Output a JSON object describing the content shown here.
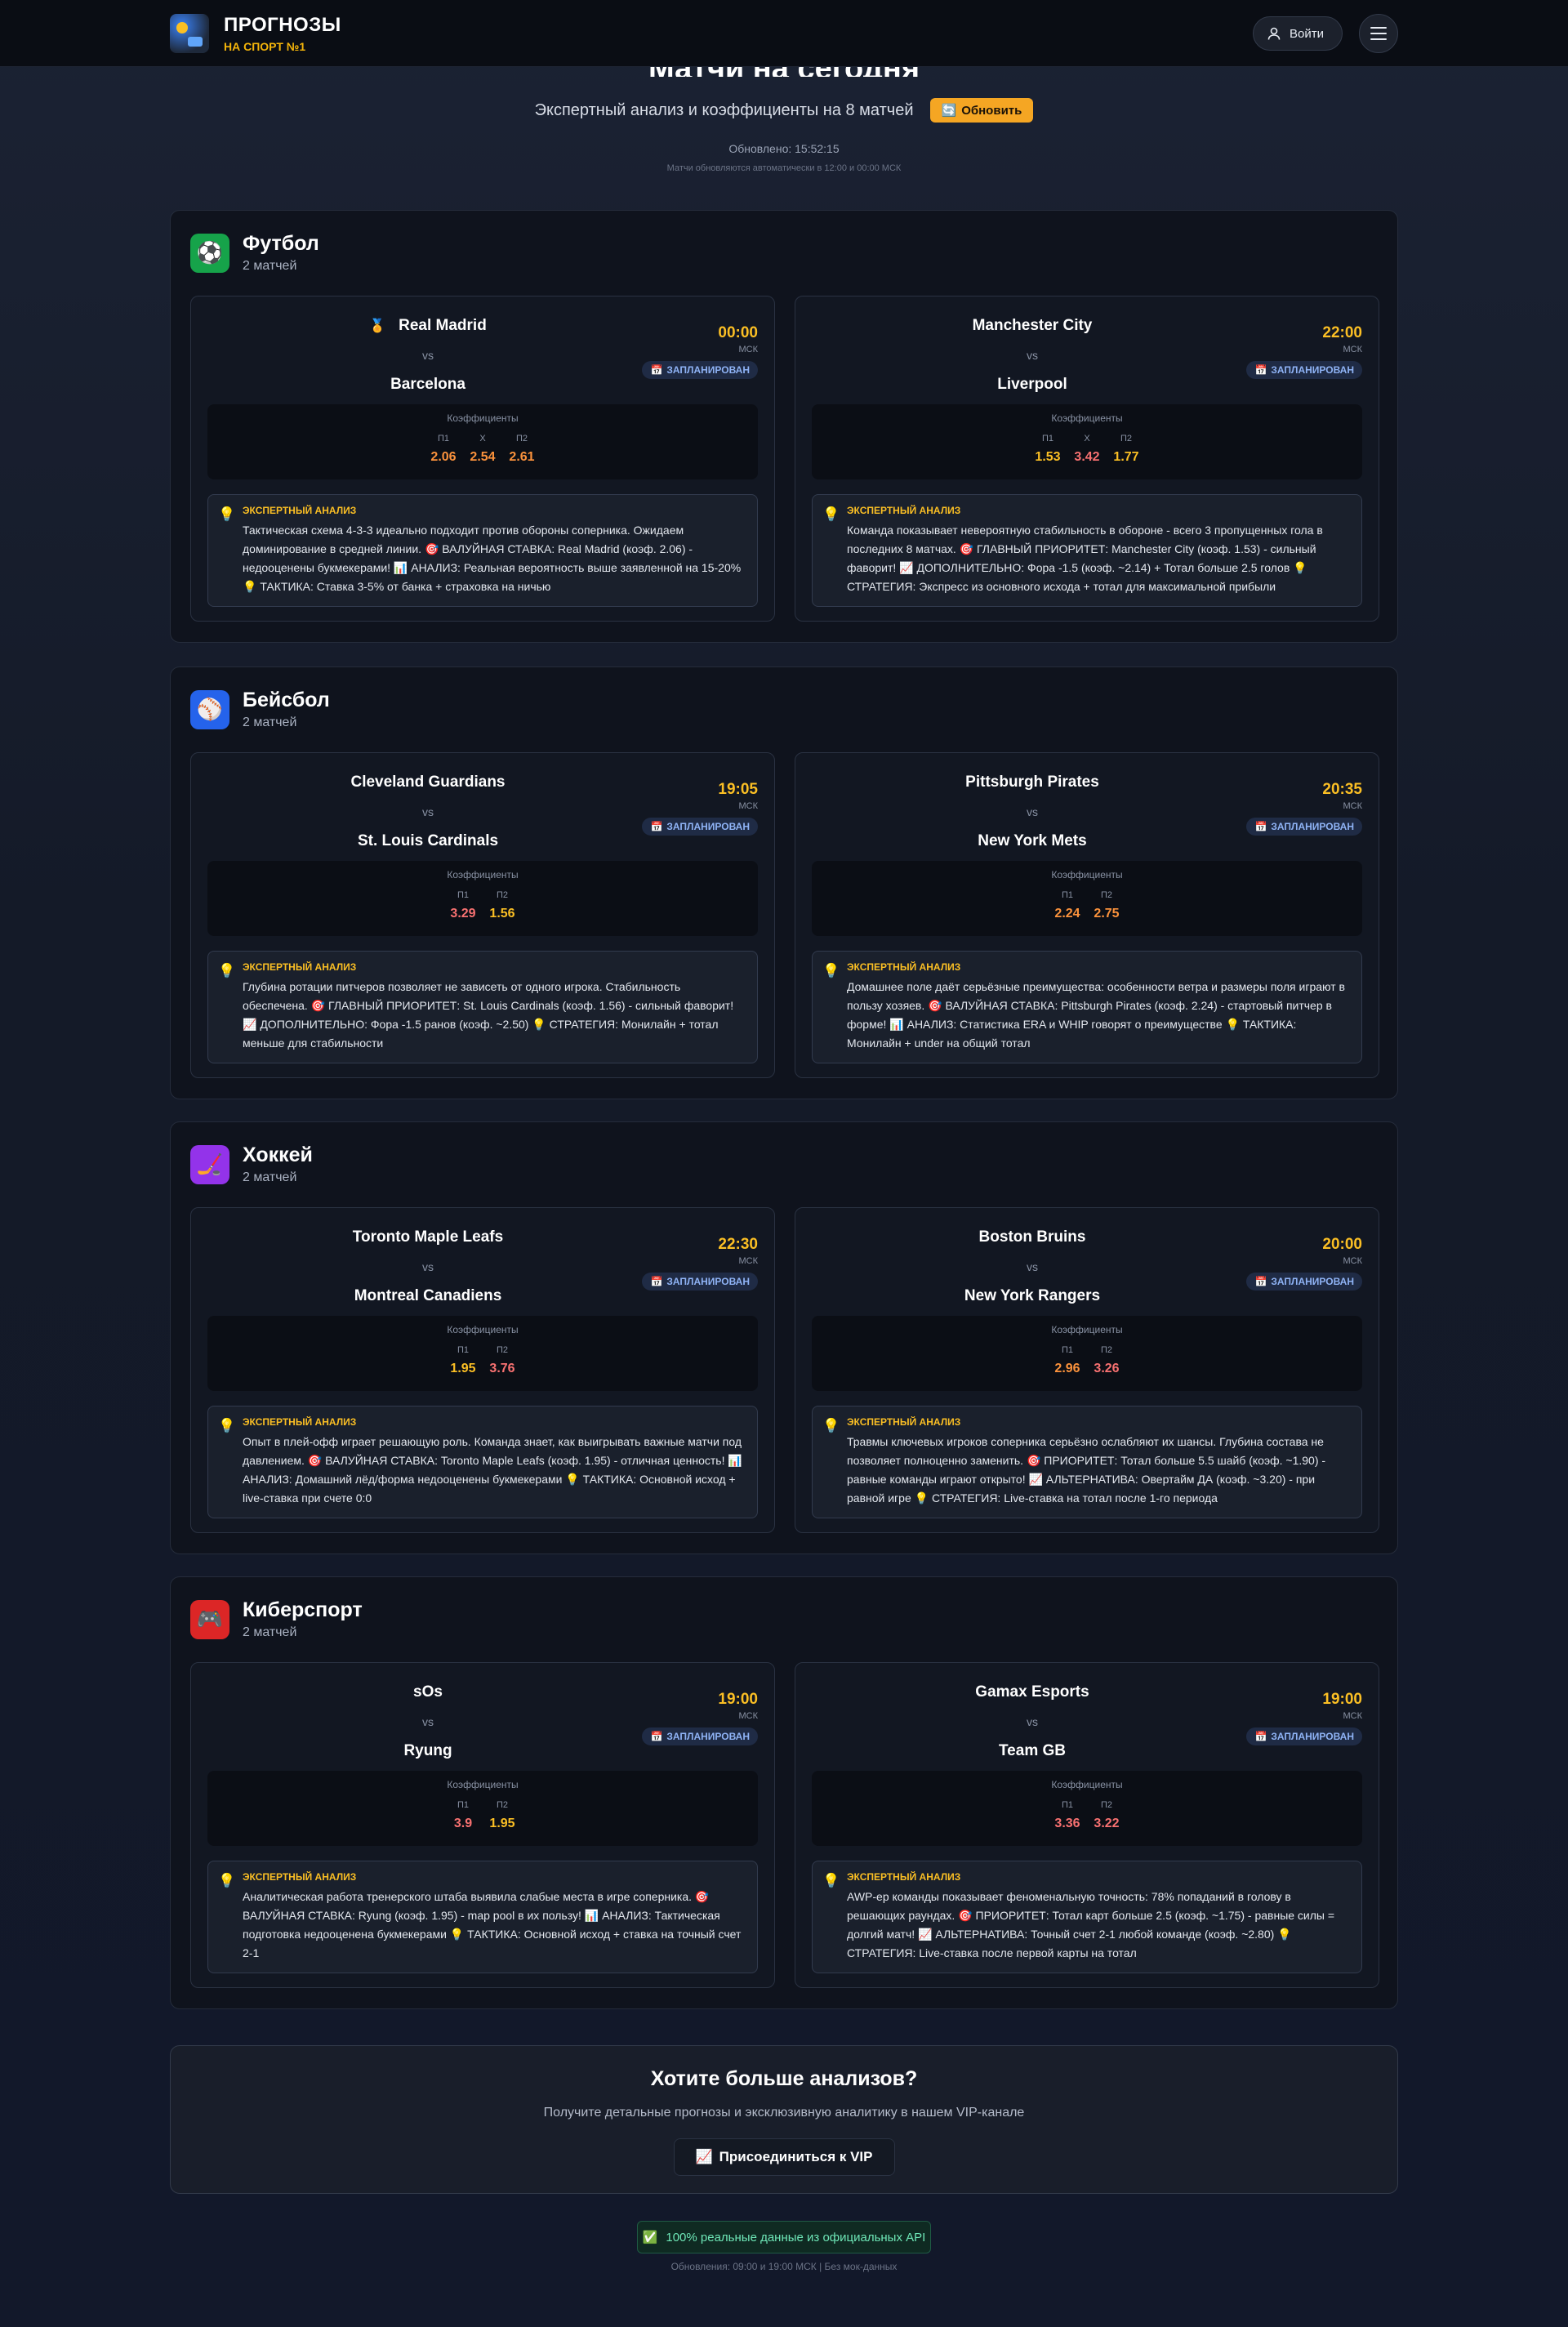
{
  "brand": {
    "title": "ПРОГНОЗЫ",
    "subtitle": "НА СПОРТ №1",
    "login_label": "Войти"
  },
  "hero": {
    "title": "Матчи на сегодня",
    "subtitle": "Экспертный анализ и коэффициенты на 8 матчей",
    "refresh_label": "Обновить",
    "updated": "Обновлено: 15:52:15",
    "note": "Матчи обновляются автоматически в 12:00 и 00:00 МСК"
  },
  "labels": {
    "vs": "vs",
    "tz": "МСК",
    "status": "ЗАПЛАНИРОВАН",
    "odds_title": "Коэффициенты",
    "p1": "П1",
    "x": "X",
    "p2": "П2",
    "analysis_title": "ЭКСПЕРТНЫЙ АНАЛИЗ"
  },
  "sections": [
    {
      "name": "Футбол",
      "count": "2 матчей",
      "icon": "soccer-ball-icon",
      "color": "#16a34a",
      "matches": [
        {
          "home": "Real Madrid",
          "away": "Barcelona",
          "time": "00:00",
          "p1": "2.06",
          "x": "2.54",
          "p2": "2.61",
          "analysis": "Тактическая схема 4-3-3 идеально подходит против обороны соперника. Ожидаем доминирование в средней линии. 🎯 ВАЛУЙНАЯ СТАВКА: Real Madrid (коэф. 2.06) - недооценены букмекерами! 📊 АНАЛИЗ: Реальная вероятность выше заявленной на 15-20% 💡 ТАКТИКА: Ставка 3-5% от банка + страховка на ничью"
        },
        {
          "home": "Manchester City",
          "away": "Liverpool",
          "time": "22:00",
          "p1": "1.53",
          "x": "3.42",
          "p2": "1.77",
          "analysis": "Команда показывает невероятную стабильность в обороне - всего 3 пропущенных гола в последних 8 матчах. 🎯 ГЛАВНЫЙ ПРИОРИТЕТ: Manchester City (коэф. 1.53) - сильный фаворит! 📈 ДОПОЛНИТЕЛЬНО: Фора -1.5 (коэф. ~2.14) + Тотал больше 2.5 голов 💡 СТРАТЕГИЯ: Экспресс из основного исхода + тотал для максимальной прибыли"
        }
      ]
    },
    {
      "name": "Бейсбол",
      "count": "2 матчей",
      "icon": "baseball-icon",
      "color": "#2563eb",
      "matches": [
        {
          "home": "Cleveland Guardians",
          "away": "St. Louis Cardinals",
          "time": "19:05",
          "p1": "3.29",
          "p2": "1.56",
          "analysis": "Глубина ротации питчеров позволяет не зависеть от одного игрока. Стабильность обеспечена. 🎯 ГЛАВНЫЙ ПРИОРИТЕТ: St. Louis Cardinals (коэф. 1.56) - сильный фаворит! 📈 ДОПОЛНИТЕЛЬНО: Фора -1.5 ранов (коэф. ~2.50) 💡 СТРАТЕГИЯ: Монилайн + тотал меньше для стабильности"
        },
        {
          "home": "Pittsburgh Pirates",
          "away": "New York Mets",
          "time": "20:35",
          "p1": "2.24",
          "p2": "2.75",
          "analysis": "Домашнее поле даёт серьёзные преимущества: особенности ветра и размеры поля играют в пользу хозяев. 🎯 ВАЛУЙНАЯ СТАВКА: Pittsburgh Pirates (коэф. 2.24) - стартовый питчер в форме! 📊 АНАЛИЗ: Статистика ERA и WHIP говорят о преимуществе 💡 ТАКТИКА: Монилайн + under на общий тотал"
        }
      ]
    },
    {
      "name": "Хоккей",
      "count": "2 матчей",
      "icon": "hockey-stick-icon",
      "color": "#9333ea",
      "matches": [
        {
          "home": "Toronto Maple Leafs",
          "away": "Montreal Canadiens",
          "time": "22:30",
          "p1": "1.95",
          "p2": "3.76",
          "analysis": "Опыт в плей-офф играет решающую роль. Команда знает, как выигрывать важные матчи под давлением. 🎯 ВАЛУЙНАЯ СТАВКА: Toronto Maple Leafs (коэф. 1.95) - отличная ценность! 📊 АНАЛИЗ: Домашний лёд/форма недооценены букмекерами 💡 ТАКТИКА: Основной исход + live-ставка при счете 0:0"
        },
        {
          "home": "Boston Bruins",
          "away": "New York Rangers",
          "time": "20:00",
          "p1": "2.96",
          "p2": "3.26",
          "analysis": "Травмы ключевых игроков соперника серьёзно ослабляют их шансы. Глубина состава не позволяет полноценно заменить. 🎯 ПРИОРИТЕТ: Тотал больше 5.5 шайб (коэф. ~1.90) - равные команды играют открыто! 📈 АЛЬТЕРНАТИВА: Овертайм ДА (коэф. ~3.20) - при равной игре 💡 СТРАТЕГИЯ: Live-ставка на тотал после 1-го периода"
        }
      ]
    },
    {
      "name": "Киберспорт",
      "count": "2 матчей",
      "icon": "gamepad-icon",
      "color": "#dc2626",
      "matches": [
        {
          "home": "sOs",
          "away": "Ryung",
          "time": "19:00",
          "p1": "3.9",
          "p2": "1.95",
          "analysis": "Аналитическая работа тренерского штаба выявила слабые места в игре соперника. 🎯 ВАЛУЙНАЯ СТАВКА: Ryung (коэф. 1.95) - map pool в их пользу! 📊 АНАЛИЗ: Тактическая подготовка недооценена букмекерами 💡 ТАКТИКА: Основной исход + ставка на точный счет 2-1"
        },
        {
          "home": "Gamax Esports",
          "away": "Team GB",
          "time": "19:00",
          "p1": "3.36",
          "p2": "3.22",
          "analysis": "AWP-ер команды показывает феноменальную точность: 78% попаданий в голову в решающих раундах. 🎯 ПРИОРИТЕТ: Тотал карт больше 2.5 (коэф. ~1.75) - равные силы = долгий матч! 📈 АЛЬТЕРНАТИВА: Точный счет 2-1 любой команде (коэф. ~2.80) 💡 СТРАТЕГИЯ: Live-ставка после первой карты на тотал"
        }
      ]
    }
  ],
  "cta": {
    "title": "Хотите больше анализов?",
    "subtitle": "Получите детальные прогнозы и эксклюзивную аналитику в нашем VIP-канале",
    "button": "Присоединиться к VIP"
  },
  "footer": {
    "badge": "100% реальные данные из официальных API",
    "note": "Обновления: 09:00 и 19:00 МСК | Без мок-данных"
  }
}
